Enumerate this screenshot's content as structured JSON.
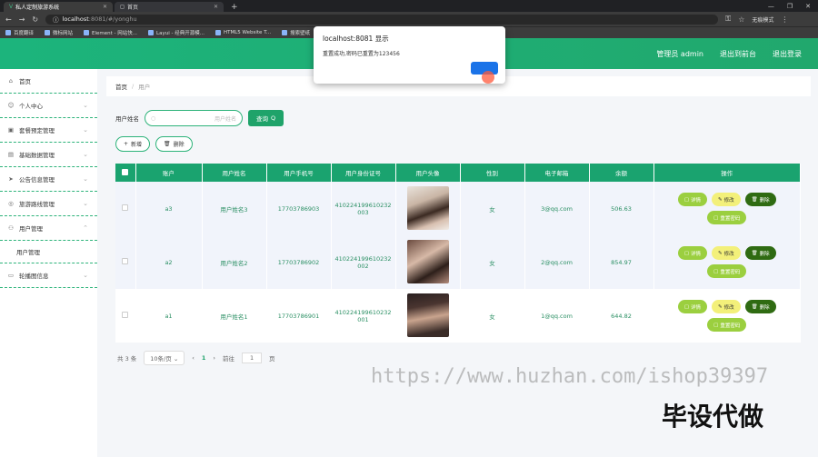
{
  "browser": {
    "tabs": [
      "私人定制旅游系统",
      "首页"
    ],
    "url_host": "localhost",
    "url_path": ":8081/#/yonghu",
    "incognito": "无痕模式",
    "bookmarks": [
      "百度翻译",
      "微标网站",
      "Element - 网站快...",
      "Layui - 经典开源模...",
      "HTML5 Website T...",
      "搜索壁纸"
    ]
  },
  "header": {
    "user": "管理员 admin",
    "logout_front": "退出到前台",
    "logout": "退出登录"
  },
  "sidebar": {
    "items": [
      {
        "icon": "home-icon",
        "label": "首页"
      },
      {
        "icon": "user-icon",
        "label": "个人中心"
      },
      {
        "icon": "folder-icon",
        "label": "套餐预定管理"
      },
      {
        "icon": "data-icon",
        "label": "基础数据管理"
      },
      {
        "icon": "send-icon",
        "label": "公告信息管理"
      },
      {
        "icon": "shield-icon",
        "label": "旅游路线管理"
      },
      {
        "icon": "group-icon",
        "label": "用户管理"
      },
      {
        "icon": "image-icon",
        "label": "轮播图信息"
      }
    ],
    "sub_active": "用户管理"
  },
  "breadcrumb": {
    "home": "首页",
    "sep": "/",
    "current": "用户"
  },
  "search": {
    "label": "用户姓名",
    "placeholder": "用户姓名",
    "button": "查询"
  },
  "actions": {
    "add": "新增",
    "delete": "删除"
  },
  "table": {
    "headers": [
      "账户",
      "用户姓名",
      "用户手机号",
      "用户身份证号",
      "用户头像",
      "性别",
      "电子邮箱",
      "余额",
      "操作"
    ],
    "rows": [
      {
        "account": "a3",
        "name": "用户姓名3",
        "phone": "17703786903",
        "id1": "410224199610232",
        "id2": "003",
        "gender": "女",
        "email": "3@qq.com",
        "balance": "506.63"
      },
      {
        "account": "a2",
        "name": "用户姓名2",
        "phone": "17703786902",
        "id1": "410224199610232",
        "id2": "002",
        "gender": "女",
        "email": "2@qq.com",
        "balance": "854.97"
      },
      {
        "account": "a1",
        "name": "用户姓名1",
        "phone": "17703786901",
        "id1": "410224199610232",
        "id2": "001",
        "gender": "女",
        "email": "1@qq.com",
        "balance": "644.82"
      }
    ],
    "ops": {
      "detail": "详情",
      "edit": "修改",
      "del": "删除",
      "reset": "重置密码"
    }
  },
  "pager": {
    "total": "共 3 条",
    "size": "10条/页",
    "page": "1",
    "goto": "前往",
    "goto_value": "1",
    "page_unit": "页"
  },
  "dialog": {
    "host": "localhost:8081 显示",
    "message": "重置成功,密码已重置为123456"
  },
  "watermark": {
    "url": "https://www.huzhan.com/ishop39397",
    "text": "毕设代做"
  }
}
